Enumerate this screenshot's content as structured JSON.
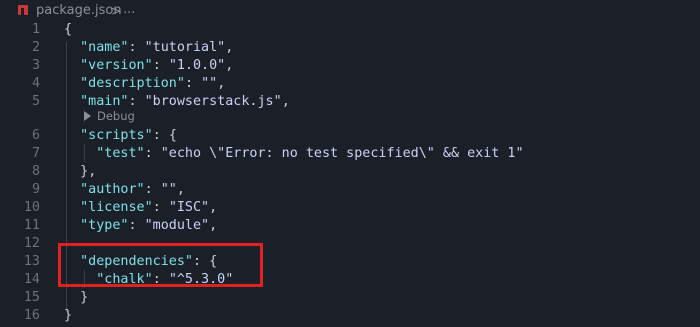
{
  "breadcrumb": {
    "file_name": "package.json",
    "separator": ">",
    "more": "..."
  },
  "codelens": {
    "label": "Debug"
  },
  "lines": [
    {
      "num": "1",
      "parts": [
        [
          "brace",
          "{"
        ]
      ]
    },
    {
      "num": "2",
      "parts": [
        [
          "ws",
          "  "
        ],
        [
          "key",
          "\"name\""
        ],
        [
          "punct",
          ": "
        ],
        [
          "str",
          "\"tutorial\""
        ],
        [
          "punct",
          ","
        ]
      ]
    },
    {
      "num": "3",
      "parts": [
        [
          "ws",
          "  "
        ],
        [
          "key",
          "\"version\""
        ],
        [
          "punct",
          ": "
        ],
        [
          "str",
          "\"1.0.0\""
        ],
        [
          "punct",
          ","
        ]
      ]
    },
    {
      "num": "4",
      "parts": [
        [
          "ws",
          "  "
        ],
        [
          "key",
          "\"description\""
        ],
        [
          "punct",
          ": "
        ],
        [
          "str",
          "\"\""
        ],
        [
          "punct",
          ","
        ]
      ]
    },
    {
      "num": "5",
      "parts": [
        [
          "ws",
          "  "
        ],
        [
          "key",
          "\"main\""
        ],
        [
          "punct",
          ": "
        ],
        [
          "str",
          "\"browserstack.js\""
        ],
        [
          "punct",
          ","
        ]
      ]
    },
    {
      "num": "6",
      "parts": [
        [
          "ws",
          "  "
        ],
        [
          "key",
          "\"scripts\""
        ],
        [
          "punct",
          ": "
        ],
        [
          "brace",
          "{"
        ]
      ]
    },
    {
      "num": "7",
      "parts": [
        [
          "ws",
          "    "
        ],
        [
          "key",
          "\"test\""
        ],
        [
          "punct",
          ": "
        ],
        [
          "str",
          "\"echo \\\"Error: no test specified\\\" && exit 1\""
        ]
      ]
    },
    {
      "num": "8",
      "parts": [
        [
          "ws",
          "  "
        ],
        [
          "brace",
          "}"
        ],
        [
          "punct",
          ","
        ]
      ]
    },
    {
      "num": "9",
      "parts": [
        [
          "ws",
          "  "
        ],
        [
          "key",
          "\"author\""
        ],
        [
          "punct",
          ": "
        ],
        [
          "str",
          "\"\""
        ],
        [
          "punct",
          ","
        ]
      ]
    },
    {
      "num": "10",
      "parts": [
        [
          "ws",
          "  "
        ],
        [
          "key",
          "\"license\""
        ],
        [
          "punct",
          ": "
        ],
        [
          "str",
          "\"ISC\""
        ],
        [
          "punct",
          ","
        ]
      ]
    },
    {
      "num": "11",
      "parts": [
        [
          "ws",
          "  "
        ],
        [
          "key",
          "\"type\""
        ],
        [
          "punct",
          ": "
        ],
        [
          "str",
          "\"module\""
        ],
        [
          "punct",
          ","
        ]
      ]
    },
    {
      "num": "12",
      "parts": []
    },
    {
      "num": "13",
      "parts": [
        [
          "ws",
          "  "
        ],
        [
          "key",
          "\"dependencies\""
        ],
        [
          "punct",
          ": "
        ],
        [
          "brace",
          "{"
        ]
      ]
    },
    {
      "num": "14",
      "parts": [
        [
          "ws",
          "    "
        ],
        [
          "key",
          "\"chalk\""
        ],
        [
          "punct",
          ": "
        ],
        [
          "str",
          "\"^5.3.0\""
        ]
      ]
    },
    {
      "num": "15",
      "parts": [
        [
          "ws",
          "  "
        ],
        [
          "brace",
          "}"
        ]
      ]
    },
    {
      "num": "16",
      "parts": [
        [
          "brace",
          "}"
        ]
      ]
    }
  ],
  "colors": {
    "background": "#1b1f27",
    "key": "#7ee0e8",
    "string": "#c7d3f5",
    "line_number": "#6b717d",
    "highlight_box": "#e0211f"
  }
}
